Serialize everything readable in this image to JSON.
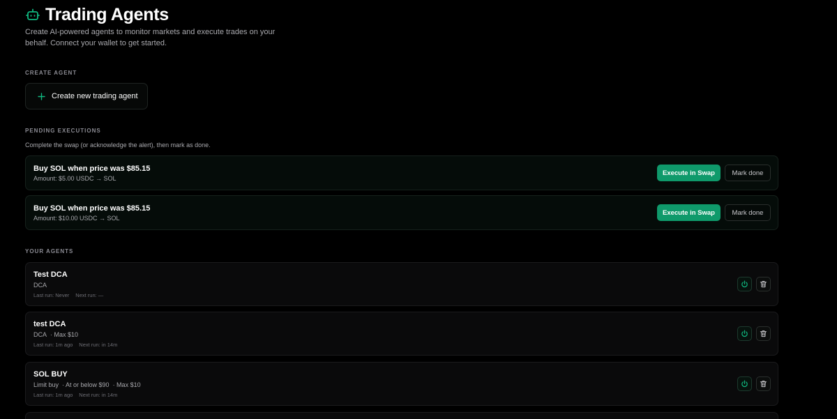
{
  "header": {
    "icon": "robot-icon",
    "title": "Trading Agents",
    "subtitle": "Create AI-powered agents to monitor markets and execute trades on your behalf. Connect your wallet to get started."
  },
  "create_section": {
    "label": "CREATE AGENT",
    "button_icon": "plus-icon",
    "button_label": "Create new trading agent"
  },
  "pending_section": {
    "label": "PENDING EXECUTIONS",
    "helper": "Complete the swap (or acknowledge the alert), then mark as done.",
    "items": [
      {
        "title": "Buy SOL when price was $85.15",
        "amount": "Amount: $5.00 USDC → SOL",
        "execute_label": "Execute in Swap",
        "done_label": "Mark done"
      },
      {
        "title": "Buy SOL when price was $85.15",
        "amount": "Amount: $10.00 USDC → SOL",
        "execute_label": "Execute in Swap",
        "done_label": "Mark done"
      }
    ]
  },
  "agents_section": {
    "label": "YOUR AGENTS",
    "items": [
      {
        "name": "Test DCA",
        "type": "DCA",
        "details": [],
        "last_run": "Last run: Never",
        "next_run": "Next run: —"
      },
      {
        "name": "test DCA",
        "type": "DCA",
        "details": [
          "· Max $10"
        ],
        "last_run": "Last run: 1m ago",
        "next_run": "Next run: in 14m"
      },
      {
        "name": "SOL BUY",
        "type": "Limit buy",
        "details": [
          "· At or below $90",
          "· Max $10"
        ],
        "last_run": "Last run: 1m ago",
        "next_run": "Next run: in 14m"
      }
    ]
  },
  "colors": {
    "background": "#000000",
    "accent": "#10b981",
    "execute_button": "#0f9a6b",
    "muted_text": "#a9a9ae"
  }
}
